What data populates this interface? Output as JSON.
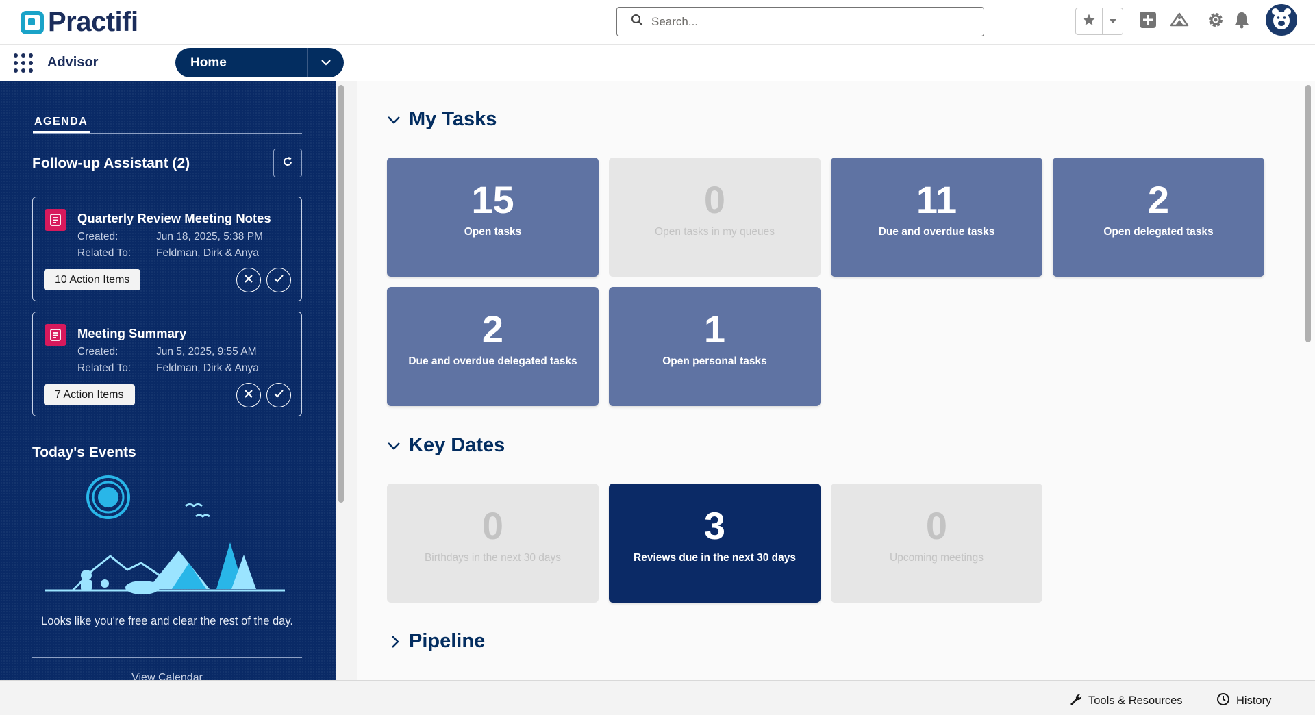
{
  "header": {
    "logo_text": "Practifi",
    "search_placeholder": "Search...",
    "icons": [
      "star-icon",
      "chevron-down-icon",
      "add-icon",
      "trailhead-icon",
      "gear-icon",
      "bell-icon",
      "avatar"
    ]
  },
  "nav": {
    "app_name": "Advisor",
    "current_page": "Home"
  },
  "sidebar": {
    "tab": "AGENDA",
    "followup_title": "Follow-up Assistant (2)",
    "cards": [
      {
        "title": "Quarterly Review Meeting Notes",
        "created_label": "Created:",
        "created_value": "Jun 18, 2025, 5:38 PM",
        "related_label": "Related To:",
        "related_value": "Feldman, Dirk & Anya",
        "action_items": "10 Action Items"
      },
      {
        "title": "Meeting Summary",
        "created_label": "Created:",
        "created_value": "Jun 5, 2025, 9:55 AM",
        "related_label": "Related To:",
        "related_value": "Feldman, Dirk & Anya",
        "action_items": "7 Action Items"
      }
    ],
    "events_title": "Today's Events",
    "free_message": "Looks like you're free and clear the rest of the day.",
    "view_calendar": "View Calendar"
  },
  "main": {
    "my_tasks": {
      "title": "My Tasks",
      "tiles": [
        {
          "value": "15",
          "label": "Open tasks",
          "state": "active"
        },
        {
          "value": "0",
          "label": "Open tasks in my queues",
          "state": "empty"
        },
        {
          "value": "11",
          "label": "Due and overdue tasks",
          "state": "active"
        },
        {
          "value": "2",
          "label": "Open delegated tasks",
          "state": "active"
        },
        {
          "value": "2",
          "label": "Due and overdue delegated tasks",
          "state": "active"
        },
        {
          "value": "1",
          "label": "Open personal tasks",
          "state": "active"
        }
      ]
    },
    "key_dates": {
      "title": "Key Dates",
      "tiles": [
        {
          "value": "0",
          "label": "Birthdays in the next 30 days",
          "state": "empty"
        },
        {
          "value": "3",
          "label": "Reviews due in the next 30 days",
          "state": "highlight"
        },
        {
          "value": "0",
          "label": "Upcoming meetings",
          "state": "empty"
        }
      ]
    },
    "pipeline": {
      "title": "Pipeline"
    }
  },
  "footer": {
    "tools": "Tools & Resources",
    "history": "History"
  },
  "colors": {
    "brand_navy": "#032d60",
    "sidebar_bg": "#0a2a66",
    "tile_blue": "#5f73a3",
    "tile_gray": "#e6e6e6",
    "tile_navy": "#0b2a66",
    "logo_teal": "#1aa3c8",
    "followup_icon": "#d7195c"
  }
}
